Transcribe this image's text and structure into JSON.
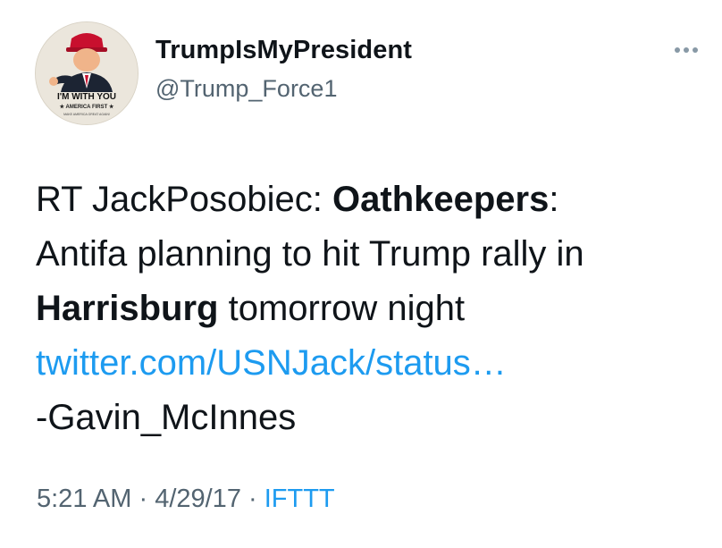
{
  "author": {
    "display_name": "TrumpIsMyPresident",
    "handle": "@Trump_Force1",
    "avatar": {
      "badge_text": "I'M WITH YOU",
      "subtext": "★ AMERICA FIRST ★",
      "fine_print": "MAKE AMERICA GREAT AGAIN!"
    }
  },
  "more_icon": "more-horizontal-icon",
  "tweet": {
    "line1_prefix": "RT JackPosobiec: ",
    "line1_bold": "Oathkeepers",
    "line1_suffix": ":",
    "line2": "Antifa planning to hit Trump rally in",
    "line3_bold": "Harrisburg",
    "line3_suffix": " tomorrow night",
    "link": "twitter.com/USNJack/status…",
    "signature": "-Gavin_McInnes"
  },
  "meta": {
    "time": "5:21 AM",
    "separator1": " · ",
    "date": "4/29/17",
    "separator2": " · ",
    "source": "IFTTT"
  },
  "colors": {
    "link": "#1d9bf0",
    "secondary_text": "#536471",
    "primary_text": "#0f1419"
  }
}
